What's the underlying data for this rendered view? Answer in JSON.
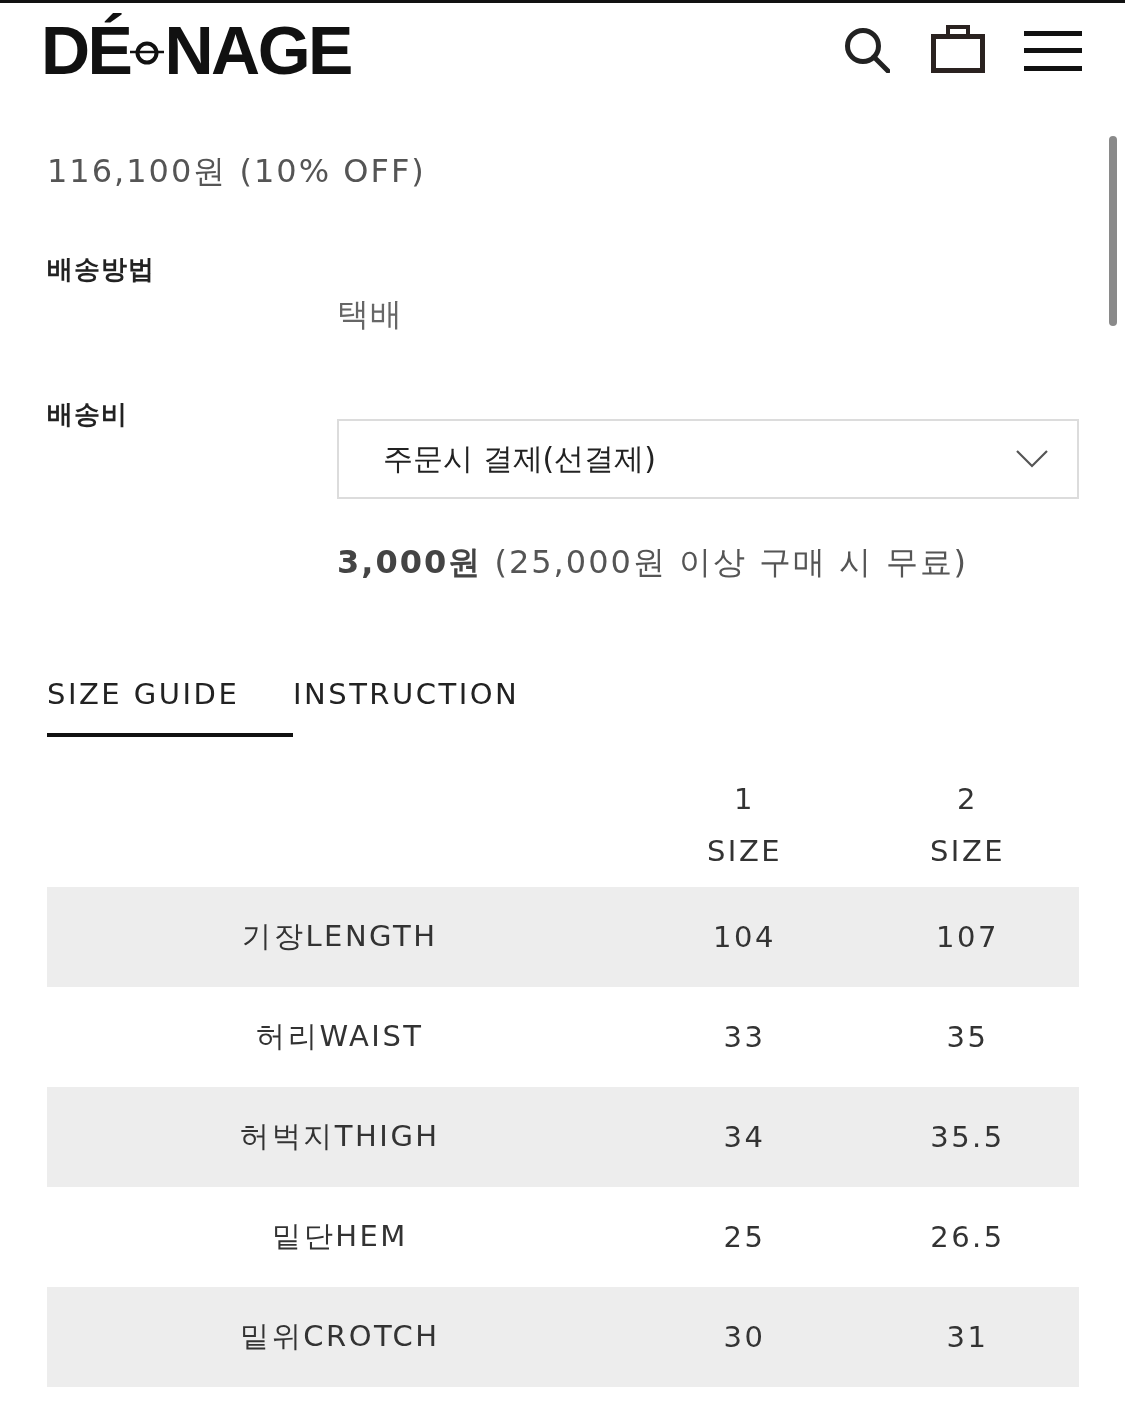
{
  "header": {
    "logo": {
      "parts": [
        "DÉ",
        "NAGE"
      ]
    }
  },
  "price": "116,100원 (10% OFF)",
  "shipping": [
    {
      "kind": "text",
      "label": "배송방법",
      "value": "택배"
    },
    {
      "kind": "select",
      "label": "배송비",
      "value": "주문시 결제(선결제)",
      "note": "**3,000원** (25,000원 이상 구매 시 무료)"
    }
  ],
  "tabs": [
    {
      "label": "SIZE GUIDE",
      "selected": true
    },
    {
      "label": "INSTRUCTION",
      "selected": false
    }
  ],
  "size_table": {
    "columns": [
      {
        "number": "1",
        "label": "SIZE"
      },
      {
        "number": "2",
        "label": "SIZE"
      }
    ],
    "rows": [
      {
        "label": "기장LENGTH",
        "values": [
          "104",
          "107"
        ]
      },
      {
        "label": "허리WAIST",
        "values": [
          "33",
          "35"
        ]
      },
      {
        "label": "허벅지THIGH",
        "values": [
          "34",
          "35.5"
        ]
      },
      {
        "label": "밑단HEM",
        "values": [
          "25",
          "26.5"
        ]
      },
      {
        "label": "밑위CROTCH",
        "values": [
          "30",
          "31"
        ]
      }
    ]
  }
}
